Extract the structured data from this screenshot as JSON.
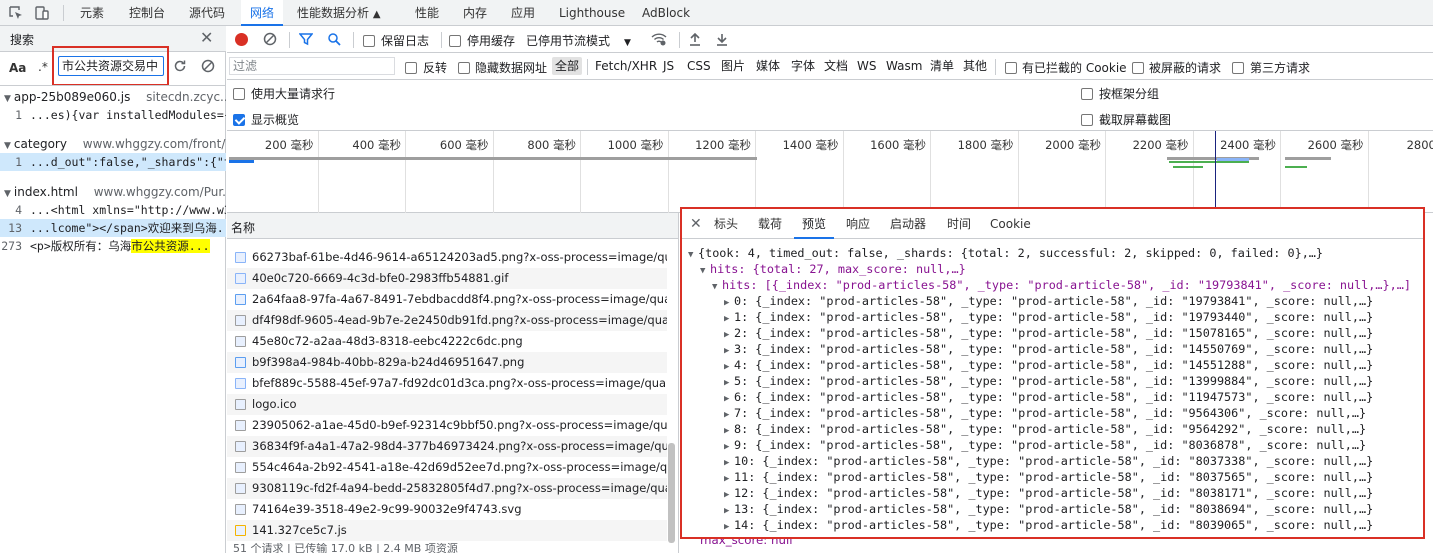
{
  "devtools_tabs": [
    {
      "label": "元素"
    },
    {
      "label": "控制台"
    },
    {
      "label": "源代码"
    },
    {
      "label": "网络"
    },
    {
      "label": "性能数据分析"
    },
    {
      "label": "性能"
    },
    {
      "label": "内存"
    },
    {
      "label": "应用"
    },
    {
      "label": "Lighthouse"
    },
    {
      "label": "AdBlock"
    }
  ],
  "search": {
    "title": "搜索",
    "aa_label": "Aa",
    "regex_label": ".*",
    "query": "市公共资源交易中",
    "results": [
      {
        "file": "app-25b089e060.js",
        "url": "sitecdn.zcyc...",
        "lines": [
          {
            "num": "1",
            "pre": "...es){var installedModules={};fun...",
            "hit": "",
            "post": ""
          }
        ]
      },
      {
        "file": "category",
        "url": "www.whggzy.com/front/...",
        "lines": [
          {
            "num": "1",
            "pre": "...d_out\":false,\"_shards\":{\"total\":...",
            "hit": "",
            "post": ""
          }
        ]
      },
      {
        "file": "index.html",
        "url": "www.whggzy.com/Pur...",
        "lines": [
          {
            "num": "4",
            "pre": "...<html xmlns=\"http://www.w3.o...",
            "hit": "",
            "post": ""
          },
          {
            "num": "13",
            "pre": "...lcome\"></span>欢迎来到乌海...",
            "hit": "",
            "post": ""
          },
          {
            "num": "273",
            "pre": "<p>版权所有：乌海",
            "hit": "市公共资源...",
            "post": ""
          }
        ]
      }
    ]
  },
  "toolbar": {
    "preserve_log": "保留日志",
    "disable_cache": "停用缓存",
    "throttling": "已停用节流模式",
    "filter_placeholder": "过滤",
    "invert": "反转",
    "hide_data_urls": "隐藏数据网址",
    "types": [
      "全部",
      "Fetch/XHR",
      "JS",
      "CSS",
      "图片",
      "媒体",
      "字体",
      "文档",
      "WS",
      "Wasm",
      "清单",
      "其他"
    ],
    "blocked_cookies": "有已拦截的 Cookie",
    "blocked_requests": "被屏蔽的请求",
    "third_party": "第三方请求",
    "big_rows": "使用大量请求行",
    "group_by_frame": "按框架分组",
    "show_overview": "显示概览",
    "capture_screenshots": "截取屏幕截图"
  },
  "overview_ticks": [
    "200 毫秒",
    "400 毫秒",
    "600 毫秒",
    "800 毫秒",
    "1000 毫秒",
    "1200 毫秒",
    "1400 毫秒",
    "1600 毫秒",
    "1800 毫秒",
    "2000 毫秒",
    "2200 毫秒",
    "2400 毫秒",
    "2600 毫秒",
    "2800 毫"
  ],
  "request_list": {
    "header": "名称",
    "rows": [
      "66273baf-61be-4d46-9614-a65124203ad5.png?x-oss-process=image/qualit...",
      "40e0c720-6669-4c3d-bfe0-2983ffb54881.gif",
      "2a64faa8-97fa-4a67-8491-7ebdbacdd8f4.png?x-oss-process=image/quality...",
      "df4f98df-9605-4ead-9b7e-2e2450db91fd.png?x-oss-process=image/quality,...",
      "45e80c72-a2aa-48d3-8318-eebc4222c6dc.png",
      "b9f398a4-984b-40bb-829a-b24d46951647.png",
      "bfef889c-5588-45ef-97a7-fd92dc01d3ca.png?x-oss-process=image/quality,...",
      "logo.ico",
      "23905062-a1ae-45d0-b9ef-92314c9bbf50.png?x-oss-process=image/qualit...",
      "36834f9f-a4a1-47a2-98d4-377b46973424.png?x-oss-process=image/qualit...",
      "554c464a-2b92-4541-a18e-42d69d52ee7d.png?x-oss-process=image/quali...",
      "9308119c-fd2f-4a94-bedd-25832805f4d7.png?x-oss-process=image/quality...",
      "74164e39-3518-49e2-9c99-90032e9f4743.svg",
      "141.327ce5c7.js"
    ],
    "status": "51 个请求  |  已传输 17.0 kB  |  2.4 MB 项资源"
  },
  "preview": {
    "tabs": [
      "标头",
      "载荷",
      "预览",
      "响应",
      "启动器",
      "时间",
      "Cookie"
    ],
    "root": "{took: 4, timed_out: false, _shards: {total: 2, successful: 2, skipped: 0, failed: 0},…}",
    "hits": "hits: {total: 27, max_score: null,…}",
    "hits_array": "hits: [{_index: \"prod-articles-58\", _type: \"prod-article-58\", _id: \"19793841\", _score: null,…},…]",
    "items": [
      "0: {_index: \"prod-articles-58\", _type: \"prod-article-58\", _id: \"19793841\", _score: null,…}",
      "1: {_index: \"prod-articles-58\", _type: \"prod-article-58\", _id: \"19793440\", _score: null,…}",
      "2: {_index: \"prod-articles-58\", _type: \"prod-article-58\", _id: \"15078165\", _score: null,…}",
      "3: {_index: \"prod-articles-58\", _type: \"prod-article-58\", _id: \"14550769\", _score: null,…}",
      "4: {_index: \"prod-articles-58\", _type: \"prod-article-58\", _id: \"14551288\", _score: null,…}",
      "5: {_index: \"prod-articles-58\", _type: \"prod-article-58\", _id: \"13999884\", _score: null,…}",
      "6: {_index: \"prod-articles-58\", _type: \"prod-article-58\", _id: \"11947573\", _score: null,…}",
      "7: {_index: \"prod-articles-58\", _type: \"prod-article-58\", _id: \"9564306\", _score: null,…}",
      "8: {_index: \"prod-articles-58\", _type: \"prod-article-58\", _id: \"9564292\", _score: null,…}",
      "9: {_index: \"prod-articles-58\", _type: \"prod-article-58\", _id: \"8036878\", _score: null,…}",
      "10: {_index: \"prod-articles-58\", _type: \"prod-article-58\", _id: \"8037338\", _score: null,…}",
      "11: {_index: \"prod-articles-58\", _type: \"prod-article-58\", _id: \"8037565\", _score: null,…}",
      "12: {_index: \"prod-articles-58\", _type: \"prod-article-58\", _id: \"8038171\", _score: null,…}",
      "13: {_index: \"prod-articles-58\", _type: \"prod-article-58\", _id: \"8038694\", _score: null,…}",
      "14: {_index: \"prod-articles-58\", _type: \"prod-article-58\", _id: \"8039065\", _score: null,…}"
    ],
    "max_score": "max_score: null",
    "total_peek": "total: 27"
  },
  "colors": {
    "accent": "#1a73e8",
    "highlight_border": "#d93025",
    "record": "#d93025"
  }
}
